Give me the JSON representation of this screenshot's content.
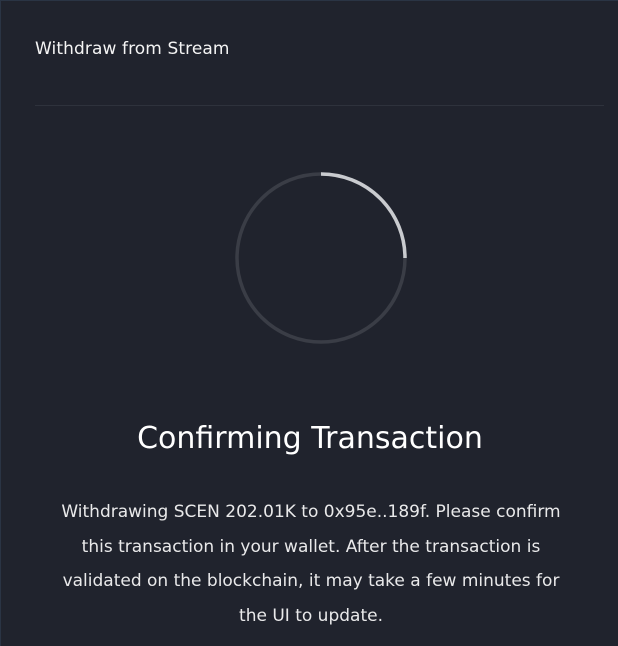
{
  "modal": {
    "title": "Withdraw from Stream"
  },
  "spinner": {
    "icon": "loading-spinner",
    "progress": 0.25,
    "track_color": "#3a3d46",
    "arc_color": "#c9cbcf"
  },
  "status": {
    "heading": "Confirming Transaction",
    "message": "Withdrawing SCEN 202.01K to 0x95e..189f. Please confirm this transaction in your wallet. After the transaction is validated on the blockchain, it may take a few minutes for the UI to update."
  }
}
